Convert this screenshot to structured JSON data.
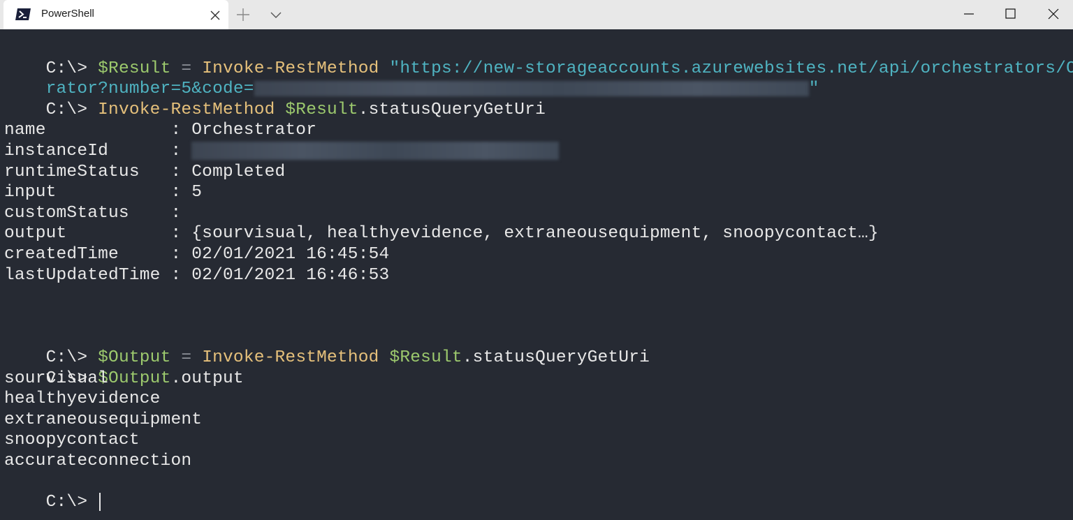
{
  "window": {
    "tab_title": "PowerShell",
    "icons": {
      "tab": "powershell-icon",
      "close_tab": "close-icon",
      "new_tab": "plus-icon",
      "dropdown": "chevron-down-icon",
      "minimize": "minimize-icon",
      "maximize": "maximize-icon",
      "close": "close-icon"
    }
  },
  "colors": {
    "background": "#262a33",
    "text": "#e8e8e8",
    "variable": "#9cc96d",
    "command": "#e5c07b",
    "string": "#4fb3c1",
    "operator": "#8c9098"
  },
  "terminal": {
    "prompt": "C:\\>",
    "line1": {
      "var": "$Result",
      "op": "=",
      "cmd": "Invoke-RestMethod",
      "str": "\"https://new-storageaccounts.azurewebsites.net/api/orchestrators/Orchest"
    },
    "line2": {
      "str": "rator?number=5&code=",
      "str_end": "\""
    },
    "line3": {
      "cmd": "Invoke-RestMethod",
      "var": "$Result",
      "rest": ".statusQueryGetUri"
    },
    "status": [
      {
        "key": "name            ",
        "value": "Orchestrator"
      },
      {
        "key": "instanceId      ",
        "value": ""
      },
      {
        "key": "runtimeStatus   ",
        "value": "Completed"
      },
      {
        "key": "input           ",
        "value": "5"
      },
      {
        "key": "customStatus    ",
        "value": ""
      },
      {
        "key": "output          ",
        "value": "{sourvisual, healthyevidence, extraneousequipment, snoopycontact…}"
      },
      {
        "key": "createdTime     ",
        "value": "02/01/2021 16:45:54"
      },
      {
        "key": "lastUpdatedTime ",
        "value": "02/01/2021 16:46:53"
      }
    ],
    "line4": {
      "var": "$Output",
      "op": "=",
      "cmd": "Invoke-RestMethod",
      "var2": "$Result",
      "rest": ".statusQueryGetUri"
    },
    "line5": {
      "var": "$Output",
      "rest": ".output"
    },
    "outputs": [
      "sourvisual",
      "healthyevidence",
      "extraneousequipment",
      "snoopycontact",
      "accurateconnection"
    ]
  }
}
